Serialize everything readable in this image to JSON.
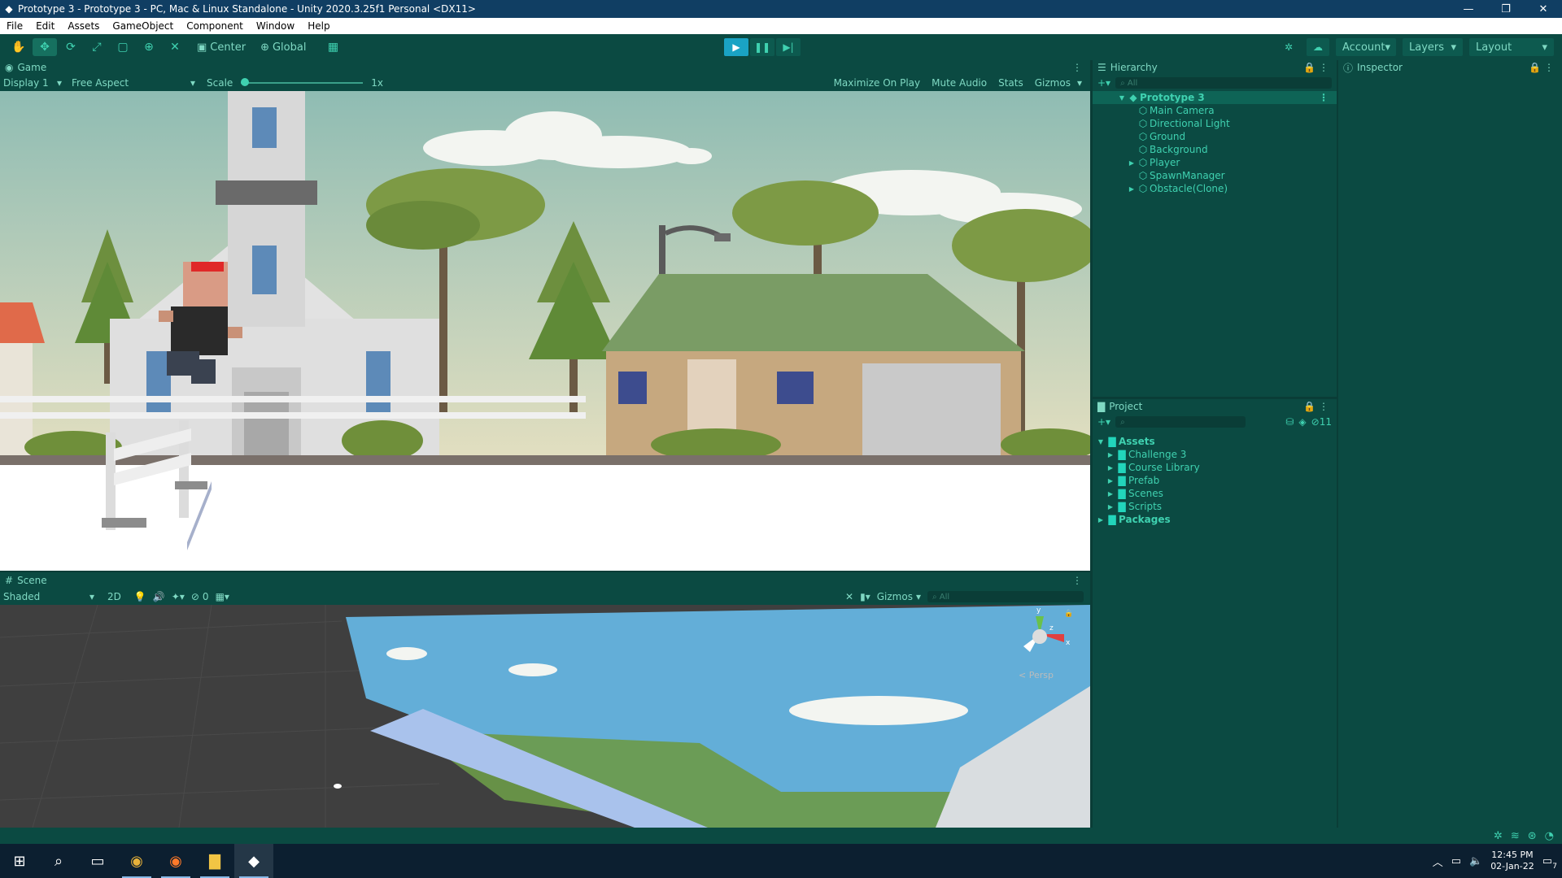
{
  "window": {
    "title": "Prototype 3 - Prototype 3 - PC, Mac & Linux Standalone - Unity 2020.3.25f1 Personal <DX11>",
    "controls": [
      "—",
      "❐",
      "✕"
    ]
  },
  "menu": [
    "File",
    "Edit",
    "Assets",
    "GameObject",
    "Component",
    "Window",
    "Help"
  ],
  "toolbar": {
    "pivot": "Center",
    "space": "Global",
    "account": "Account",
    "layers": "Layers",
    "layout": "Layout"
  },
  "game": {
    "tab": "Game",
    "display": "Display 1",
    "aspect": "Free Aspect",
    "scale_label": "Scale",
    "scale_value": "1x",
    "maximize": "Maximize On Play",
    "mute": "Mute Audio",
    "stats": "Stats",
    "gizmos": "Gizmos"
  },
  "scene": {
    "tab": "Scene",
    "shading": "Shaded",
    "mode2d": "2D",
    "hidden_count": "0",
    "gizmos": "Gizmos",
    "search_placeholder": "All",
    "persp": "< Persp",
    "axis_y": "y",
    "axis_x": "x",
    "axis_z": "z"
  },
  "hierarchy": {
    "tab": "Hierarchy",
    "search_placeholder": "All",
    "root": "Prototype 3",
    "items": [
      {
        "label": "Main Camera",
        "expandable": false
      },
      {
        "label": "Directional Light",
        "expandable": false
      },
      {
        "label": "Ground",
        "expandable": false
      },
      {
        "label": "Background",
        "expandable": false
      },
      {
        "label": "Player",
        "expandable": true
      },
      {
        "label": "SpawnManager",
        "expandable": false
      },
      {
        "label": "Obstacle(Clone)",
        "expandable": true
      }
    ]
  },
  "project": {
    "tab": "Project",
    "hidden_count": "11",
    "assets": "Assets",
    "folders": [
      "Challenge 3",
      "Course Library",
      "Prefab",
      "Scenes",
      "Scripts"
    ],
    "packages": "Packages"
  },
  "inspector": {
    "tab": "Inspector"
  },
  "taskbar": {
    "time": "12:45 PM",
    "date": "02-Jan-22",
    "notifications": "7"
  },
  "colors": {
    "panel": "#0b4a42",
    "accent": "#3fd1b0",
    "play_active": "#1aa3c4",
    "titlebar": "#103e63"
  }
}
